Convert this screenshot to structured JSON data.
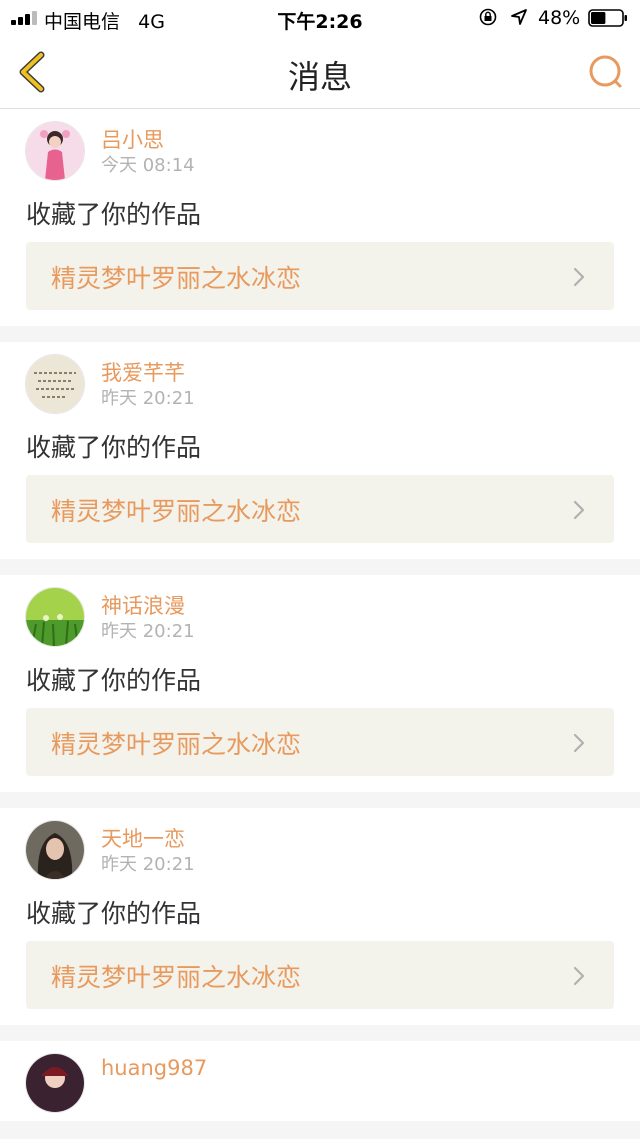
{
  "status_bar": {
    "carrier": "中国电信",
    "network": "4G",
    "time": "下午2:26",
    "battery_percent": "48%",
    "battery_level": 0.48
  },
  "nav": {
    "title": "消息",
    "back_icon": "chevron-left-icon",
    "search_icon": "search-icon"
  },
  "colors": {
    "accent": "#e89a5e",
    "back_icon": "#f0c020",
    "link_bg": "#f3f3ec"
  },
  "messages": [
    {
      "user": "吕小思",
      "time": "今天 08:14",
      "text": "收藏了你的作品",
      "work": "精灵梦叶罗丽之水冰恋"
    },
    {
      "user": "我爱芊芊",
      "time": "昨天 20:21",
      "text": "收藏了你的作品",
      "work": "精灵梦叶罗丽之水冰恋"
    },
    {
      "user": "神话浪漫",
      "time": "昨天 20:21",
      "text": "收藏了你的作品",
      "work": "精灵梦叶罗丽之水冰恋"
    },
    {
      "user": "天地一恋",
      "time": "昨天 20:21",
      "text": "收藏了你的作品",
      "work": "精灵梦叶罗丽之水冰恋"
    },
    {
      "user": "huang987"
    }
  ]
}
